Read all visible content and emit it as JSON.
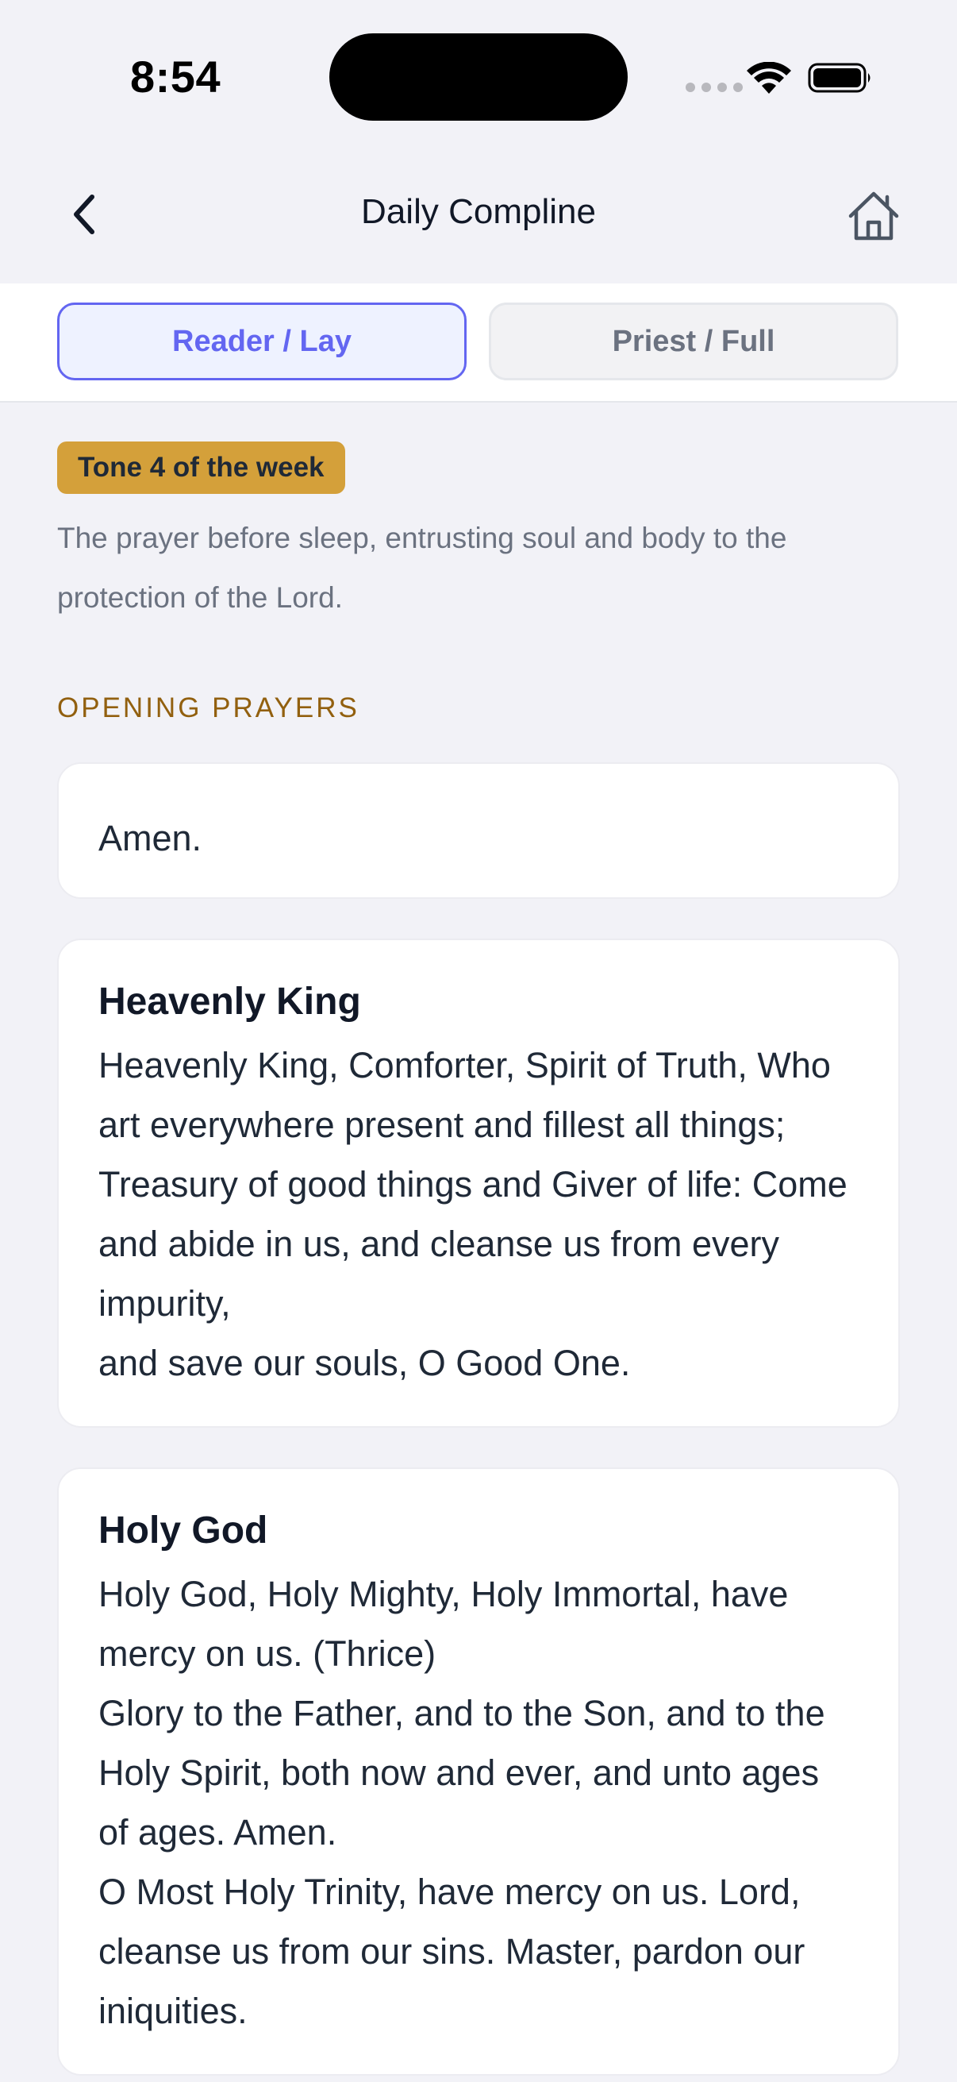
{
  "status_bar": {
    "time": "8:54"
  },
  "header": {
    "title": "Daily Compline",
    "back_icon": "chevron-left-icon",
    "home_icon": "home-icon"
  },
  "mode_toggle": {
    "options": [
      {
        "label": "Reader / Lay",
        "selected": true
      },
      {
        "label": "Priest / Full",
        "selected": false
      }
    ]
  },
  "intro": {
    "tone_badge": "Tone 4 of the week",
    "description": "The prayer before sleep, entrusting soul and body to the protection of the Lord."
  },
  "section": {
    "heading": "OPENING PRAYERS"
  },
  "prayers": [
    {
      "title": "",
      "lines": [
        "Amen."
      ]
    },
    {
      "title": "Heavenly King",
      "lines": [
        "Heavenly King, Comforter, Spirit of Truth, Who art everywhere present and fillest all things;",
        "Treasury of good things and Giver of life: Come and abide in us, and cleanse us from every impurity,",
        "and save our souls, O Good One."
      ]
    },
    {
      "title": "Holy God",
      "lines": [
        "Holy God, Holy Mighty, Holy Immortal, have mercy on us. (Thrice)",
        "Glory to the Father, and to the Son, and to the Holy Spirit, both now and ever, and unto ages of ages. Amen.",
        "O Most Holy Trinity, have mercy on us. Lord, cleanse us from our sins. Master, pardon our iniquities."
      ]
    }
  ],
  "colors": {
    "accent": "#6366f1",
    "badge": "#d4a03a",
    "section_heading": "#92600f",
    "background": "#f2f2f7"
  }
}
